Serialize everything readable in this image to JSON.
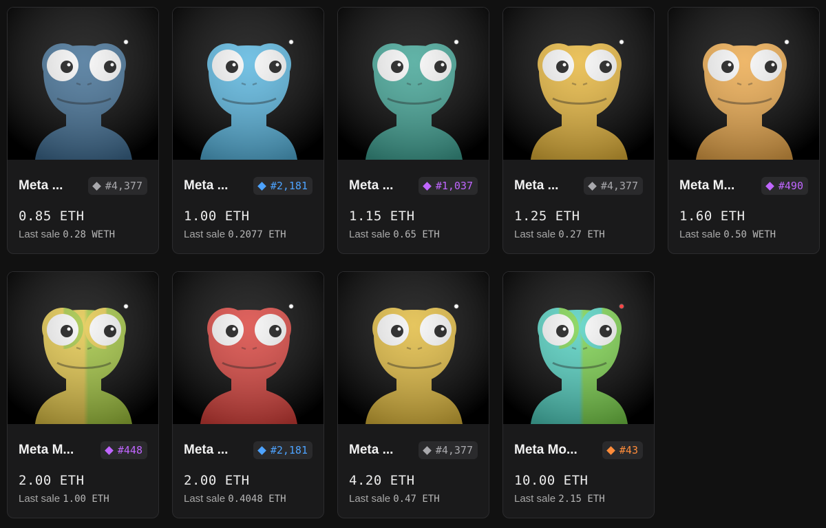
{
  "colors": {
    "page_bg": "#111111",
    "card_bg": "#1a1a1b",
    "rarity": {
      "gray": "#a9a9ad",
      "blue": "#4da3ff",
      "purple": "#c066ff",
      "orange": "#ff8c3a"
    }
  },
  "last_sale_label": "Last sale",
  "items": [
    {
      "name": "Meta ...",
      "rank": "#4,377",
      "rarity": "gray",
      "price": "0.85 ETH",
      "last_sale": "0.28 WETH",
      "skin": "#3f6d93",
      "skin2": "#3f6d93",
      "dot": "#ffffff"
    },
    {
      "name": "Meta ...",
      "rank": "#2,181",
      "rarity": "blue",
      "price": "1.00 ETH",
      "last_sale": "0.2077 ETH",
      "skin": "#56b4de",
      "skin2": "#56b4de",
      "dot": "#ffffff"
    },
    {
      "name": "Meta ...",
      "rank": "#1,037",
      "rarity": "purple",
      "price": "1.15 ETH",
      "last_sale": "0.65 ETH",
      "skin": "#3fa394",
      "skin2": "#3fa394",
      "dot": "#ffffff"
    },
    {
      "name": "Meta ...",
      "rank": "#4,377",
      "rarity": "gray",
      "price": "1.25 ETH",
      "last_sale": "0.27 ETH",
      "skin": "#e6b53a",
      "skin2": "#e6b53a",
      "dot": "#ffffff"
    },
    {
      "name": "Meta M...",
      "rank": "#490",
      "rarity": "purple",
      "price": "1.60 ETH",
      "last_sale": "0.50 WETH",
      "skin": "#eba84a",
      "skin2": "#eba84a",
      "dot": "#ffffff"
    },
    {
      "name": "Meta M...",
      "rank": "#448",
      "rarity": "purple",
      "price": "2.00 ETH",
      "last_sale": "1.00 ETH",
      "skin": "#e2c547",
      "skin2": "#9fc23c",
      "dot": "#ffffff"
    },
    {
      "name": "Meta ...",
      "rank": "#2,181",
      "rarity": "blue",
      "price": "2.00 ETH",
      "last_sale": "0.4048 ETH",
      "skin": "#d8403a",
      "skin2": "#d8403a",
      "dot": "#ffffff"
    },
    {
      "name": "Meta ...",
      "rank": "#4,377",
      "rarity": "gray",
      "price": "4.20 ETH",
      "last_sale": "0.47 ETH",
      "skin": "#e0b93c",
      "skin2": "#e0b93c",
      "dot": "#ffffff"
    },
    {
      "name": "Meta Mo...",
      "rank": "#43",
      "rarity": "orange",
      "price": "10.00 ETH",
      "last_sale": "2.15 ETH",
      "skin": "#4fcfbf",
      "skin2": "#79d04a",
      "dot": "#ff4444"
    }
  ]
}
